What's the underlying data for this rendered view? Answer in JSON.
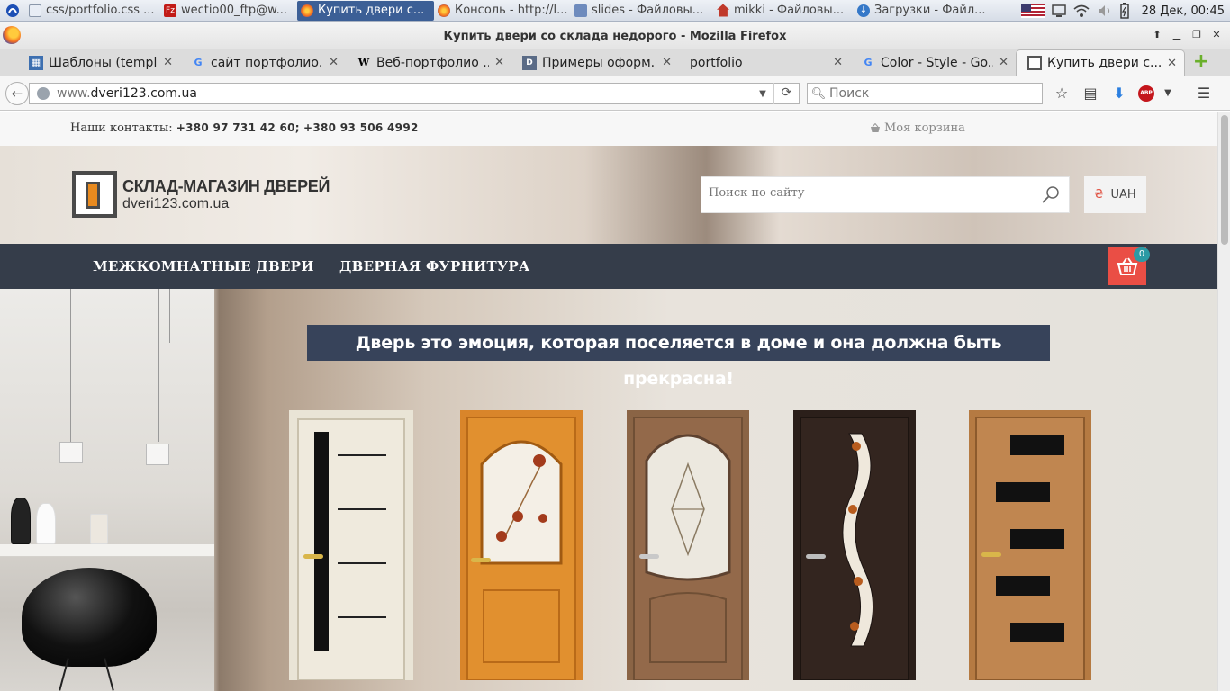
{
  "taskbar": {
    "tasks": [
      {
        "label": "css/portfolio.css ...",
        "active": false
      },
      {
        "label": "wectio00_ftp@w...",
        "active": false
      },
      {
        "label": "Купить двери с...",
        "active": true
      },
      {
        "label": "Консоль - http://l...",
        "active": false
      },
      {
        "label": "slides - Файловы...",
        "active": false
      },
      {
        "label": "mikki - Файловы...",
        "active": false
      },
      {
        "label": "Загрузки - Файл...",
        "active": false
      }
    ],
    "clock": "28 Дек, 00:45"
  },
  "window": {
    "title": "Купить двери со склада недорого - Mozilla Firefox"
  },
  "tabs": [
    {
      "label": "Шаблоны (templ...",
      "icon": "template-icon"
    },
    {
      "label": "сайт портфолио...",
      "icon": "google-icon"
    },
    {
      "label": "Веб-портфолио ...",
      "icon": "wikipedia-icon"
    },
    {
      "label": "Примеры оформ...",
      "icon": "doc-icon"
    },
    {
      "label": "portfolio",
      "icon": "blank-icon"
    },
    {
      "label": "Color - Style - Go...",
      "icon": "google-icon"
    },
    {
      "label": "Купить двери с...",
      "icon": "site-icon",
      "active": true
    }
  ],
  "navbar": {
    "url_prefix": "www.",
    "url_domain": "dveri123.com.ua",
    "search_placeholder": "Поиск"
  },
  "page": {
    "contacts_label": "Наши контакты:",
    "phone1": "+380 97 731 42 60;",
    "phone2": "+380 93 506 4992",
    "cart_link": "Моя корзина",
    "logo_line1": "СКЛАД-МАГАЗИН ДВЕРЕЙ",
    "logo_line2": "dveri123.com.ua",
    "search_placeholder": "Поиск по сайту",
    "currency": "UAH",
    "currency_sign": "₴",
    "menu": [
      "МЕЖКОМНАТНЫЕ ДВЕРИ",
      "ДВЕРНАЯ ФУРНИТУРА"
    ],
    "cart_count": "0",
    "slogan": "Дверь это эмоция, которая поселяется в доме и она должна быть прекрасна!"
  },
  "colors": {
    "menu_bg": "#353d4a",
    "cart_button": "#ea4e45",
    "badge": "#2c9aa4",
    "slogan_bg": "#37435a",
    "taskbar_active": "#3c5f96"
  }
}
